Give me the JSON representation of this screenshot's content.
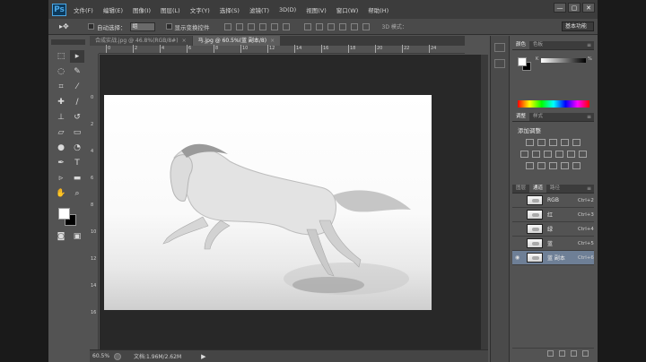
{
  "app": {
    "logo": "Ps"
  },
  "menu": [
    "文件(F)",
    "编辑(E)",
    "图像(I)",
    "图层(L)",
    "文字(Y)",
    "选择(S)",
    "滤镜(T)",
    "3D(D)",
    "视图(V)",
    "窗口(W)",
    "帮助(H)"
  ],
  "window_controls": {
    "minimize": "—",
    "restore": "▢",
    "close": "✕"
  },
  "options": {
    "auto_select_label": "自动选择：",
    "auto_select_value": "组",
    "show_transform_label": "显示变换控件",
    "mode3d_label": "3D 模式：",
    "workspace": "基本功能"
  },
  "tabs": [
    {
      "label": "合成实战.jpg @ 46.8%(RGB/8#)",
      "close": "×"
    },
    {
      "label": "马.jpg @ 60.5%(蓝 副本/8)",
      "close": "×"
    }
  ],
  "ruler_top": [
    "0",
    "2",
    "4",
    "6",
    "8",
    "10",
    "12",
    "14",
    "16",
    "18",
    "20",
    "22",
    "24"
  ],
  "ruler_left": [
    "0",
    "2",
    "4",
    "6",
    "8",
    "10",
    "12",
    "14",
    "16"
  ],
  "status": {
    "zoom": "60.5%",
    "doc_info": "文档:1.96M/2.62M",
    "arrow": "▶"
  },
  "color_panel": {
    "tabs": [
      "颜色",
      "色板"
    ],
    "k_label": "K",
    "value": "0",
    "unit": "%"
  },
  "adjust_panel": {
    "tabs": [
      "调整",
      "样式"
    ],
    "title": "添加调整"
  },
  "channels_panel": {
    "tabs": [
      "图层",
      "通道",
      "路径"
    ],
    "rows": [
      {
        "name": "RGB",
        "key": "Ctrl+2",
        "visible": false,
        "selected": false
      },
      {
        "name": "红",
        "key": "Ctrl+3",
        "visible": false,
        "selected": false
      },
      {
        "name": "绿",
        "key": "Ctrl+4",
        "visible": false,
        "selected": false
      },
      {
        "name": "蓝",
        "key": "Ctrl+5",
        "visible": false,
        "selected": false
      },
      {
        "name": "蓝 副本",
        "key": "Ctrl+6",
        "visible": true,
        "selected": true
      }
    ]
  },
  "tools": [
    "move",
    "marquee",
    "lasso",
    "quick-select",
    "crop",
    "eyedropper",
    "healing",
    "brush",
    "stamp",
    "history-brush",
    "eraser",
    "gradient",
    "blur",
    "dodge",
    "pen",
    "type",
    "path-select",
    "shape",
    "hand",
    "zoom"
  ]
}
